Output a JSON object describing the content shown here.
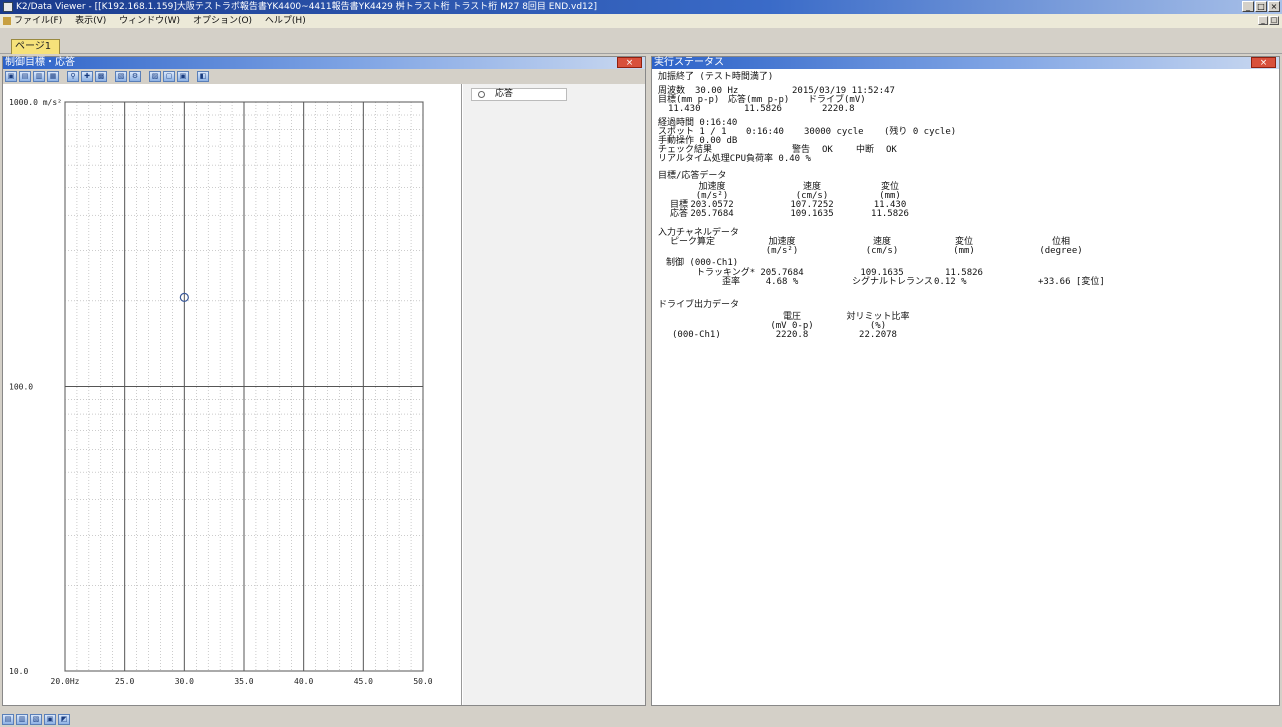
{
  "window": {
    "title": "K2/Data Viewer - [[K192.168.1.159]大阪テストラボ報告書YK4400~4411報告書YK4429 桝トラスト桁 トラスト桁 M27 8回目 END.vd12]",
    "controls": [
      "_",
      "□",
      "×"
    ]
  },
  "menu": {
    "items": [
      "ファイル(F)",
      "表示(V)",
      "ウィンドウ(W)",
      "オプション(O)",
      "ヘルプ(H)"
    ]
  },
  "tabs": [
    {
      "label": "ページ1"
    }
  ],
  "graph_panel": {
    "title": "制御目標・応答",
    "close_label": "×",
    "toolbar_icons": [
      "save-icon",
      "copy-icon",
      "export-icon",
      "print-icon",
      "zoom-icon",
      "cursor-icon",
      "grid-icon",
      "scale-icon",
      "settings-icon",
      "log-icon",
      "linear-icon",
      "text-icon"
    ],
    "legend": {
      "label": "応答"
    }
  },
  "chart_data": {
    "type": "scatter",
    "x_scale": "linear",
    "y_scale": "log",
    "xlim": [
      20.0,
      50.0
    ],
    "ylim": [
      10.0,
      1000.0
    ],
    "x_ticks": [
      "20.0Hz",
      "25.0",
      "30.0",
      "35.0",
      "40.0",
      "45.0",
      "50.0"
    ],
    "y_ticks": [
      "1000.0 m/s²",
      "100.0",
      "10.0"
    ],
    "grid": true,
    "series": [
      {
        "name": "応答",
        "marker": "circle-open",
        "points": [
          {
            "x": 30.0,
            "y": 205.7684
          }
        ]
      }
    ]
  },
  "status_panel": {
    "title": "実行ステータス",
    "close_label": "×",
    "state": "加振終了 (テスト時間満了)",
    "frequency_label": "周波数",
    "frequency_value": "30.00 Hz",
    "datetime": "2015/03/19 11:52:47",
    "summary_headers": [
      "目標(mm p-p)",
      "応答(mm p-p)",
      "ドライブ(mV)"
    ],
    "summary_values": [
      "11.430",
      "11.5826",
      "2220.8"
    ],
    "elapsed": "経過時間 0:16:40",
    "spot_label": "スポット 1 / 1",
    "spot_time": "0:16:40",
    "spot_cycles": "30000 cycle",
    "spot_remaining": "(残り 0 cycle)",
    "manual_op": "手動操作   0.00 dB",
    "check_label": "チェック結果",
    "warning_label": "警告",
    "warning_value": "OK",
    "abort_label": "中断",
    "abort_value": "OK",
    "cpu_load": "リアルタイム処理CPU負荷率   0.40 %",
    "target_response": {
      "heading": "目標/応答データ",
      "col_names": [
        "加速度",
        "速度",
        "変位"
      ],
      "col_units": [
        "(m/s²)",
        "(cm/s)",
        "(mm)"
      ],
      "rows": [
        {
          "label": "目標",
          "values": [
            "203.0572",
            "107.7252",
            "11.430"
          ]
        },
        {
          "label": "応答",
          "values": [
            "205.7684",
            "109.1635",
            "11.5826"
          ]
        }
      ]
    },
    "input_channel": {
      "heading": "入力チャネルデータ",
      "peak_label": "ピーク算定",
      "col_names": [
        "加速度",
        "速度",
        "変位",
        "位相"
      ],
      "col_units": [
        "(m/s²)",
        "(cm/s)",
        "(mm)",
        "(degree)"
      ],
      "channel": "制御 (000-Ch1)",
      "tracking_label": "トラッキング*",
      "tracking_values": [
        "205.7684",
        "109.1635",
        "11.5826"
      ],
      "distortion_label": "歪率",
      "distortion_value": "4.68 %",
      "snr_label": "シグナルトレランス",
      "snr_value": "0.12 %",
      "phase_value": "+33.66 [変位]"
    },
    "drive_output": {
      "heading": "ドライブ出力データ",
      "col_names": [
        "電圧",
        "対リミット比率"
      ],
      "col_units": [
        "(mV 0-p)",
        "(%)"
      ],
      "channel": "(000-Ch1)",
      "values": [
        "2220.8",
        "22.2078"
      ]
    }
  },
  "bottom_toolbar": {
    "icons": [
      "tile-h-icon",
      "tile-v-icon",
      "cascade-icon",
      "close-all-icon",
      "layout-icon"
    ]
  }
}
